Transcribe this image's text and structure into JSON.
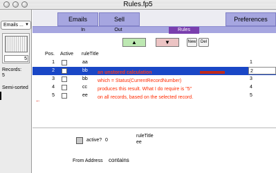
{
  "window": {
    "title": "Rules.fp5"
  },
  "status_area": {
    "layout_menu": "Emails ...",
    "record_number": "5",
    "records_label": "Records:",
    "records_count": "5",
    "sort_status": "Semi-sorted"
  },
  "nav": {
    "emails": "Emails",
    "sell": "Sell",
    "preferences": "Preferences"
  },
  "subtabs": {
    "in": "In",
    "out": "Out",
    "rules": "Rules"
  },
  "toolbar": {
    "up": "▲",
    "down": "▼",
    "new": "New",
    "del": "Del"
  },
  "columns": {
    "pos": "Pos.",
    "active": "Active",
    "rule_title": "ruleTitle"
  },
  "rows": [
    {
      "pos": "1",
      "title": "aa",
      "calc": "1"
    },
    {
      "pos": "2",
      "title": "bb",
      "calc": "2"
    },
    {
      "pos": "3",
      "title": "bb",
      "calc": "3"
    },
    {
      "pos": "4",
      "title": "cc",
      "calc": "4"
    },
    {
      "pos": "5",
      "title": "ee",
      "calc": "5"
    }
  ],
  "annotation": {
    "header": "an unstored calculation",
    "line1": "which = Status(CurrentRecordNumber)",
    "line2": "produces this result. What I do require is \"5\"",
    "line3": "on all records, based on the selected record.",
    "arrow": "←"
  },
  "detail": {
    "active_label": "active?",
    "active_value": "0",
    "rule_title_label": "ruleTitle",
    "rule_title_value": "ee",
    "from_label": "From Address",
    "from_value": "contains"
  },
  "colors": {
    "tab_fill": "#a6a6e0",
    "active_tab": "#7a3fae",
    "selection": "#1a47c6",
    "annotation": "#ff2a00",
    "up_button": "#bde8b2",
    "down_button": "#ecc4c4"
  }
}
